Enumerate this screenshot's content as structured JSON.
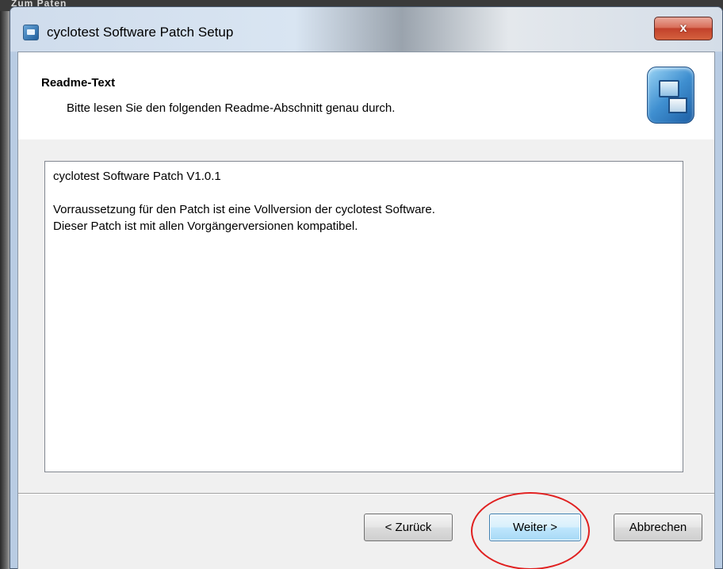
{
  "window": {
    "title": "cyclotest Software Patch Setup",
    "close_label": "x"
  },
  "background": {
    "partial_text": "Zum Paten"
  },
  "header": {
    "title": "Readme-Text",
    "subtitle": "Bitte lesen Sie den folgenden Readme-Abschnitt genau durch.",
    "icon": "setup-computer-icon"
  },
  "readme": {
    "lines": [
      "cyclotest Software Patch V1.0.1",
      "",
      "Vorraussetzung für den Patch ist eine Vollversion der cyclotest Software.",
      "Dieser Patch ist mit allen Vorgängerversionen kompatibel."
    ]
  },
  "buttons": {
    "back_label": "< Zurück",
    "next_label": "Weiter >",
    "cancel_label": "Abbrechen"
  },
  "annotation": {
    "highlight_color": "#e02020",
    "highlighted": "next-button"
  }
}
